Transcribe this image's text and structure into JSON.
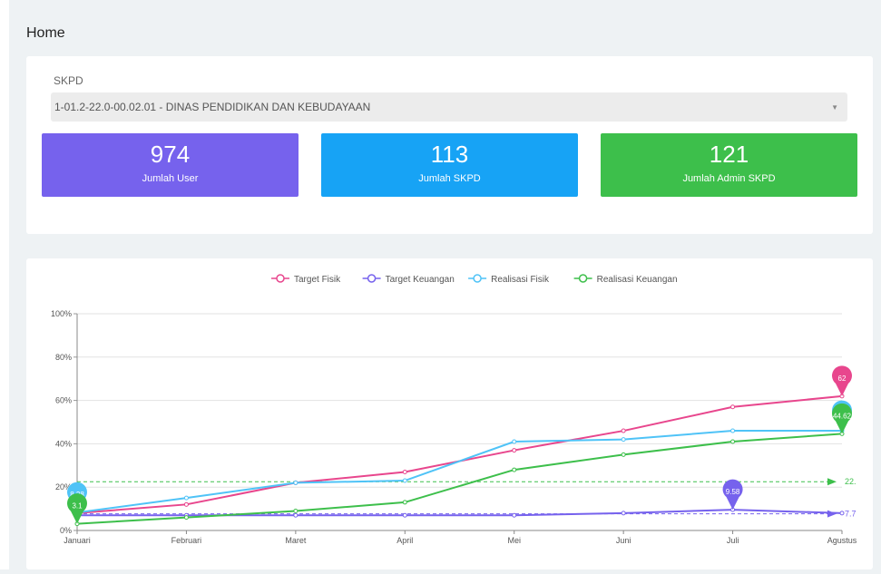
{
  "page": {
    "title": "Home"
  },
  "filter": {
    "label": "SKPD",
    "selected": "1-01.2-22.0-00.02.01 - DINAS PENDIDIKAN DAN KEBUDAYAAN",
    "caret_icon": "caret-down-icon"
  },
  "stats": [
    {
      "value": "974",
      "label": "Jumlah User",
      "color": "#7662ed"
    },
    {
      "value": "113",
      "label": "Jumlah SKPD",
      "color": "#17a3f5"
    },
    {
      "value": "121",
      "label": "Jumlah Admin SKPD",
      "color": "#3dbf4b"
    }
  ],
  "chart_data": {
    "type": "line",
    "x": [
      "Januari",
      "Februari",
      "Maret",
      "April",
      "Mei",
      "Juni",
      "Juli",
      "Agustus"
    ],
    "ylim": [
      0,
      100
    ],
    "y_ticks": [
      "0%",
      "20%",
      "40%",
      "60%",
      "80%",
      "100%"
    ],
    "grid": true,
    "legend_position": "top-center",
    "series": [
      {
        "name": "Target Fisik",
        "color": "#e8468d",
        "values": [
          8,
          12,
          22,
          27,
          37,
          46,
          57,
          62
        ]
      },
      {
        "name": "Target Keuangan",
        "color": "#7662ed",
        "values": [
          7,
          7,
          7,
          7,
          7,
          8,
          9.58,
          8
        ]
      },
      {
        "name": "Realisasi Fisik",
        "color": "#4fc3f7",
        "values": [
          8.28,
          15,
          22,
          23,
          41,
          42,
          46,
          46
        ]
      },
      {
        "name": "Realisasi Keuangan",
        "color": "#3dbf4b",
        "values": [
          3.1,
          6,
          9,
          13,
          28,
          35,
          41,
          44.62
        ]
      }
    ],
    "point_markers": [
      {
        "series": 0,
        "index": 7,
        "label": "62"
      },
      {
        "series": 1,
        "index": 6,
        "label": "9.58"
      },
      {
        "series": 2,
        "index": 7,
        "label": ""
      },
      {
        "series": 3,
        "index": 7,
        "label": "44.62"
      },
      {
        "series": 2,
        "index": 0,
        "label": "8.28"
      },
      {
        "series": 3,
        "index": 0,
        "label": "3.1"
      }
    ],
    "average_lines": [
      {
        "color": "#3dbf4b",
        "value": 22.5,
        "label": "22."
      },
      {
        "color": "#7662ed",
        "value": 7.7,
        "label": "7.7"
      }
    ]
  }
}
